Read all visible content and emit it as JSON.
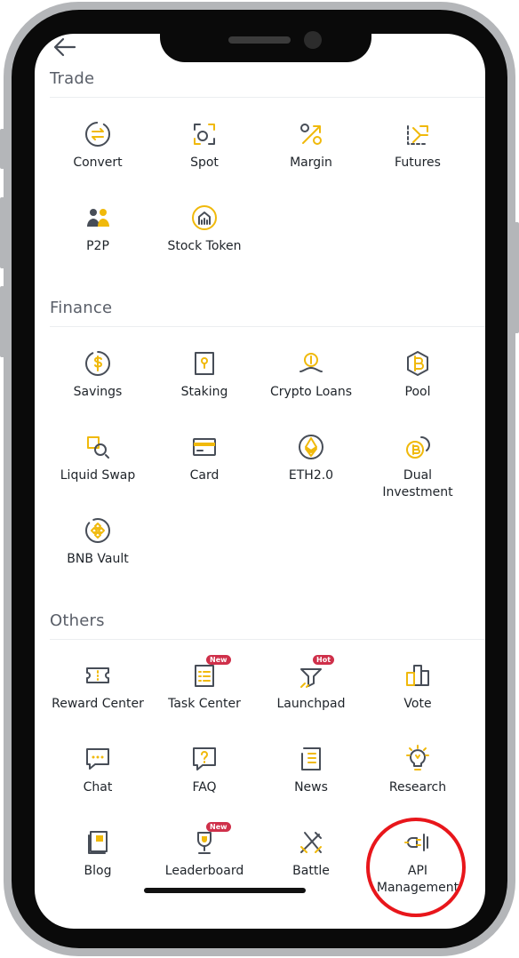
{
  "colors": {
    "accent": "#f0b90b",
    "icon_dark": "#474d57",
    "text": "#1e2329",
    "section": "#595e68",
    "highlight": "#e8161b",
    "badge": "#cf304a"
  },
  "nav": {
    "back_icon": "arrow-left"
  },
  "sections": [
    {
      "title": "Trade",
      "items": [
        {
          "label": "Convert",
          "icon": "convert"
        },
        {
          "label": "Spot",
          "icon": "spot"
        },
        {
          "label": "Margin",
          "icon": "margin"
        },
        {
          "label": "Futures",
          "icon": "futures"
        },
        {
          "label": "P2P",
          "icon": "p2p"
        },
        {
          "label": "Stock Token",
          "icon": "stock-token"
        }
      ]
    },
    {
      "title": "Finance",
      "items": [
        {
          "label": "Savings",
          "icon": "savings"
        },
        {
          "label": "Staking",
          "icon": "staking"
        },
        {
          "label": "Crypto Loans",
          "icon": "crypto-loans"
        },
        {
          "label": "Pool",
          "icon": "pool"
        },
        {
          "label": "Liquid Swap",
          "icon": "liquid-swap"
        },
        {
          "label": "Card",
          "icon": "card"
        },
        {
          "label": "ETH2.0",
          "icon": "eth2"
        },
        {
          "label": "Dual\nInvestment",
          "icon": "dual-investment"
        },
        {
          "label": "BNB Vault",
          "icon": "bnb-vault"
        }
      ]
    },
    {
      "title": "Others",
      "items": [
        {
          "label": "Reward Center",
          "icon": "reward-center"
        },
        {
          "label": "Task Center",
          "icon": "task-center",
          "badge": "New"
        },
        {
          "label": "Launchpad",
          "icon": "launchpad",
          "badge": "Hot"
        },
        {
          "label": "Vote",
          "icon": "vote"
        },
        {
          "label": "Chat",
          "icon": "chat"
        },
        {
          "label": "FAQ",
          "icon": "faq"
        },
        {
          "label": "News",
          "icon": "news"
        },
        {
          "label": "Research",
          "icon": "research"
        },
        {
          "label": "Blog",
          "icon": "blog"
        },
        {
          "label": "Leaderboard",
          "icon": "leaderboard",
          "badge": "New"
        },
        {
          "label": "Battle",
          "icon": "battle"
        },
        {
          "label": "API\nManagement",
          "icon": "api-management",
          "highlighted": true
        }
      ]
    }
  ]
}
